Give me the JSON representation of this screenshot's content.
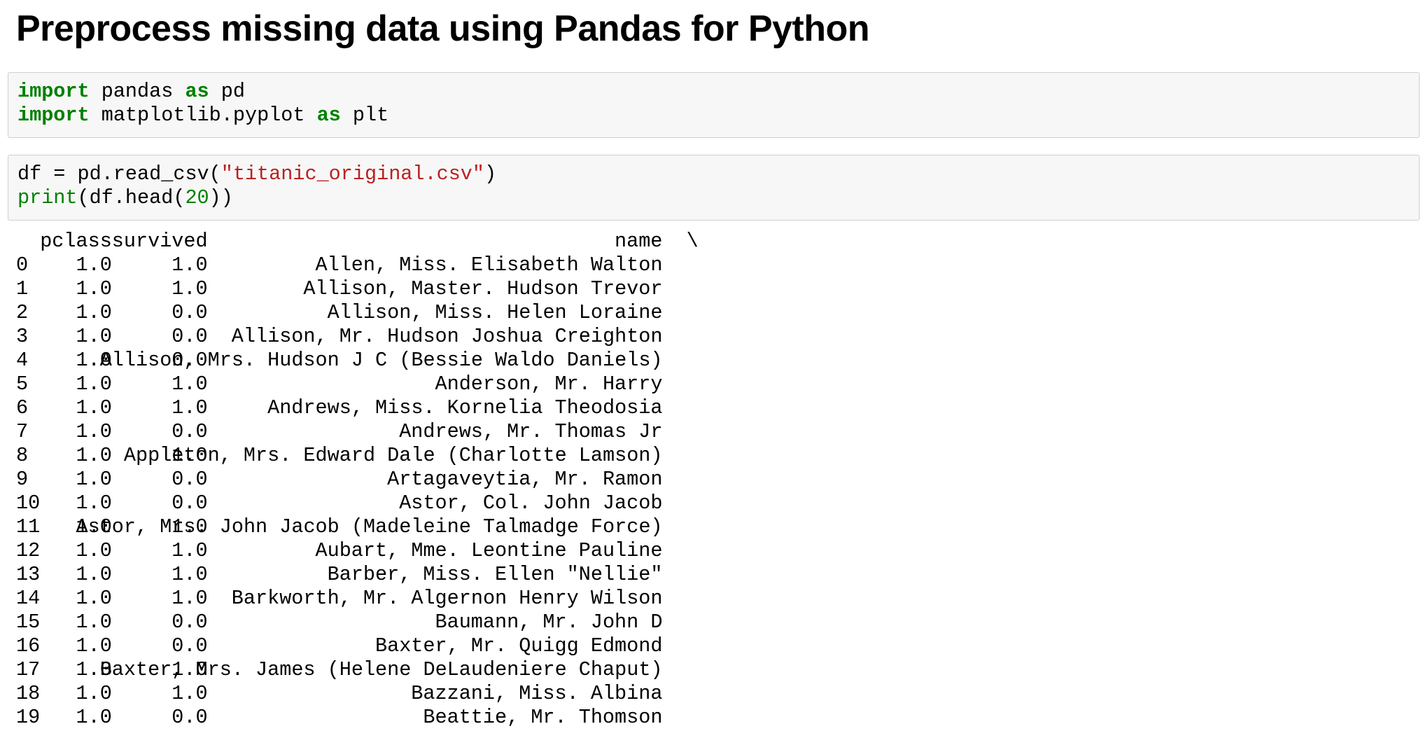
{
  "page": {
    "title": "Preprocess missing data using Pandas for Python"
  },
  "cells": [
    {
      "lines": [
        [
          {
            "t": "import",
            "c": "kw"
          },
          {
            "t": " pandas ",
            "c": ""
          },
          {
            "t": "as",
            "c": "kw"
          },
          {
            "t": " pd",
            "c": ""
          }
        ],
        [
          {
            "t": "import",
            "c": "kw"
          },
          {
            "t": " matplotlib.pyplot ",
            "c": ""
          },
          {
            "t": "as",
            "c": "kw"
          },
          {
            "t": " plt",
            "c": ""
          }
        ]
      ]
    },
    {
      "lines": [
        [
          {
            "t": "df = pd.read_csv(",
            "c": ""
          },
          {
            "t": "\"titanic_original.csv\"",
            "c": "str"
          },
          {
            "t": ")",
            "c": ""
          }
        ],
        [
          {
            "t": "print",
            "c": "bi"
          },
          {
            "t": "(df.head(",
            "c": ""
          },
          {
            "t": "20",
            "c": "num"
          },
          {
            "t": "))",
            "c": ""
          }
        ]
      ]
    }
  ],
  "output": {
    "header": {
      "pclass": "pclass",
      "survived": "survived",
      "name": "name",
      "continuation": "\\"
    },
    "rows": [
      {
        "idx": "0",
        "pclass": "1.0",
        "survived": "1.0",
        "name": "Allen, Miss. Elisabeth Walton"
      },
      {
        "idx": "1",
        "pclass": "1.0",
        "survived": "1.0",
        "name": "Allison, Master. Hudson Trevor"
      },
      {
        "idx": "2",
        "pclass": "1.0",
        "survived": "0.0",
        "name": "Allison, Miss. Helen Loraine"
      },
      {
        "idx": "3",
        "pclass": "1.0",
        "survived": "0.0",
        "name": "Allison, Mr. Hudson Joshua Creighton"
      },
      {
        "idx": "4",
        "pclass": "1.0",
        "survived": "0.0",
        "name": "Allison, Mrs. Hudson J C (Bessie Waldo Daniels)"
      },
      {
        "idx": "5",
        "pclass": "1.0",
        "survived": "1.0",
        "name": "Anderson, Mr. Harry"
      },
      {
        "idx": "6",
        "pclass": "1.0",
        "survived": "1.0",
        "name": "Andrews, Miss. Kornelia Theodosia"
      },
      {
        "idx": "7",
        "pclass": "1.0",
        "survived": "0.0",
        "name": "Andrews, Mr. Thomas Jr"
      },
      {
        "idx": "8",
        "pclass": "1.0",
        "survived": "1.0",
        "name": "Appleton, Mrs. Edward Dale (Charlotte Lamson)"
      },
      {
        "idx": "9",
        "pclass": "1.0",
        "survived": "0.0",
        "name": "Artagaveytia, Mr. Ramon"
      },
      {
        "idx": "10",
        "pclass": "1.0",
        "survived": "0.0",
        "name": "Astor, Col. John Jacob"
      },
      {
        "idx": "11",
        "pclass": "1.0",
        "survived": "1.0",
        "name": "Astor, Mrs. John Jacob (Madeleine Talmadge Force)"
      },
      {
        "idx": "12",
        "pclass": "1.0",
        "survived": "1.0",
        "name": "Aubart, Mme. Leontine Pauline"
      },
      {
        "idx": "13",
        "pclass": "1.0",
        "survived": "1.0",
        "name": "Barber, Miss. Ellen \"Nellie\""
      },
      {
        "idx": "14",
        "pclass": "1.0",
        "survived": "1.0",
        "name": "Barkworth, Mr. Algernon Henry Wilson"
      },
      {
        "idx": "15",
        "pclass": "1.0",
        "survived": "0.0",
        "name": "Baumann, Mr. John D"
      },
      {
        "idx": "16",
        "pclass": "1.0",
        "survived": "0.0",
        "name": "Baxter, Mr. Quigg Edmond"
      },
      {
        "idx": "17",
        "pclass": "1.0",
        "survived": "1.0",
        "name": "Baxter, Mrs. James (Helene DeLaudeniere Chaput)"
      },
      {
        "idx": "18",
        "pclass": "1.0",
        "survived": "1.0",
        "name": "Bazzani, Miss. Albina"
      },
      {
        "idx": "19",
        "pclass": "1.0",
        "survived": "0.0",
        "name": "Beattie, Mr. Thomson"
      }
    ]
  },
  "colors": {
    "keyword": "#008000",
    "string": "#ba2121",
    "cell_background": "#f7f7f7",
    "cell_border": "#cfcfcf"
  }
}
